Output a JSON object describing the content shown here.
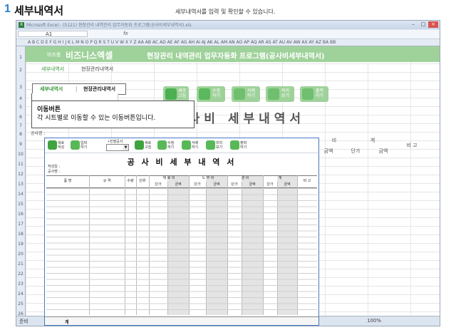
{
  "page": {
    "step_number": "1",
    "step_title": "세부내역서",
    "description": "세부내역서를 입력 및 확인할 수 있습니다."
  },
  "excel": {
    "window_title": "Microsoft Excel - (5121) 현장관리 내역관리 업무자동화 프로그램(공사비세부내역서).xls",
    "name_box": "A1",
    "fx_label": "fx",
    "column_letters": "A B C D E F G H I J K L M N O P Q R S T U V W X Y Z AA AB AC AD AE AF AG AH AI AJ AK AL AM AN AO AP AQ AR AS AT AU AV AW AX AY AZ BA BB",
    "row_numbers": [
      "1",
      "2",
      "3",
      "4",
      "5",
      "6",
      "7",
      "8",
      "9",
      "10",
      "11",
      "12",
      "13",
      "14",
      "15",
      "16",
      "17",
      "18",
      "19",
      "20",
      "21",
      "22",
      "23",
      "24",
      "25",
      "26"
    ],
    "status_left": "준비",
    "zoom_label": "100%"
  },
  "banner": {
    "brand_small": "비즈폼",
    "brand": "비즈니스엑셀",
    "program": "현장관리 내역관리 업무자동화 프로그램(공사비세부내역서)"
  },
  "subtabs": {
    "detail": "세부내역서",
    "manage": "현장관리내역서"
  },
  "background": {
    "title": "공사비 세부내역서",
    "new_label": "새로\n고침",
    "edit_label": "수정\n하기",
    "delete_label": "삭제\n하기",
    "preview_label": "미리\n보기",
    "print_label": "출력\n하기",
    "author_label": "공사명 :",
    "headers": {
      "amount_group1": "비",
      "total": "계",
      "remark": "비 고",
      "amount": "금액",
      "unit": "단가",
      "amount2": "금액"
    }
  },
  "callout": {
    "tab_detail": "세부내역서",
    "separator": "|",
    "tab_manage": "현장관리내역서",
    "heading": "이동버튼",
    "body": "각 시트별로 이동할 수 있는 이동버튼입니다."
  },
  "form": {
    "buttons": {
      "new": "새로\n작성",
      "input": "입력\n하기",
      "refresh": "새로\n고침",
      "edit": "수정\n하기",
      "delete": "삭제\n하기",
      "preview": "미리\n보기",
      "print": "출력\n하기"
    },
    "combo_label": "•진행공사",
    "title": "공 사 비  세 부 내 역 서",
    "writer_label": "작성일 :",
    "project_label": "공사명 :",
    "group_headers": [
      "품   명",
      "규   격",
      "수량",
      "단위",
      "재  료  비",
      "노  무  비",
      "경    비",
      "계",
      "비  고"
    ],
    "sub_headers": [
      "단가",
      "금액",
      "단가",
      "금액",
      "단가",
      "금액",
      "단가",
      "금액"
    ],
    "footer_label": "계"
  },
  "colors": {
    "banner_green": "#9fd29a",
    "accent_green": "#3b9a3b",
    "form_border": "#4a78c2",
    "excel_frame": "#dfe7f1"
  }
}
